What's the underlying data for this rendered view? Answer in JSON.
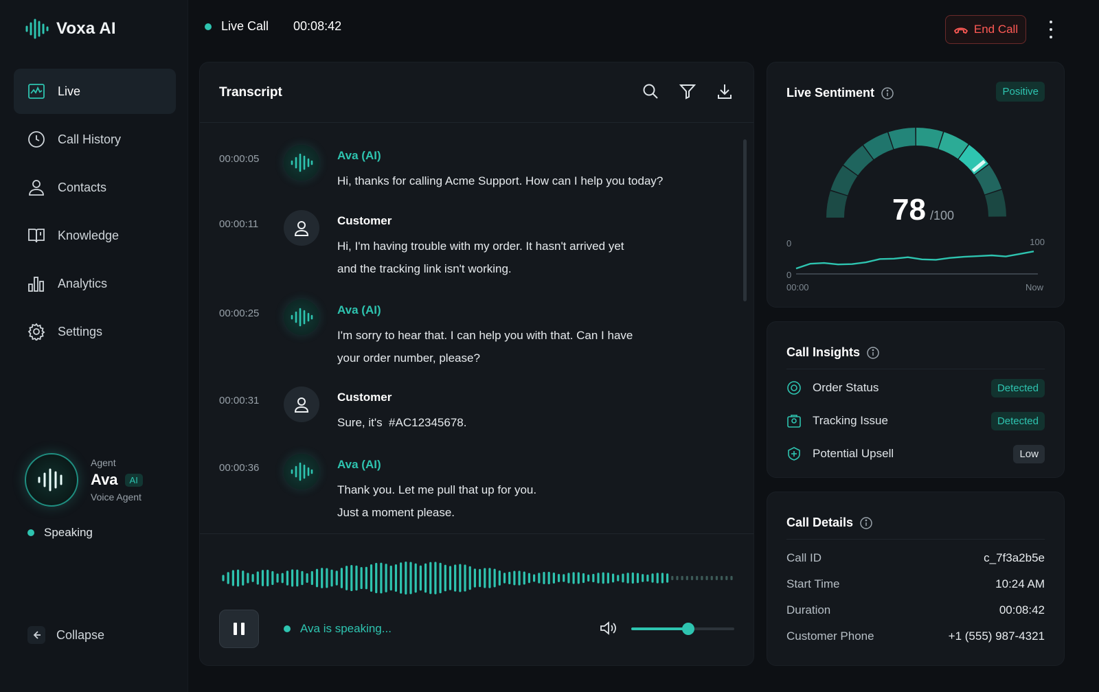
{
  "app": {
    "name": "Voxa AI"
  },
  "nav": {
    "items": [
      {
        "label": "Live",
        "icon": "live-monitor-icon",
        "active": true
      },
      {
        "label": "Call History",
        "icon": "clock-icon"
      },
      {
        "label": "Contacts",
        "icon": "user-icon"
      },
      {
        "label": "Knowledge",
        "icon": "book-icon"
      },
      {
        "label": "Analytics",
        "icon": "bar-chart-icon"
      },
      {
        "label": "Settings",
        "icon": "gear-icon"
      }
    ],
    "collapse_label": "Collapse"
  },
  "agent": {
    "role_label": "Agent",
    "name": "Ava",
    "badge": "AI",
    "subtitle": "Voice Agent",
    "status": "Speaking"
  },
  "topbar": {
    "status": "Live Call",
    "elapsed": "00:08:42",
    "end_call_label": "End Call"
  },
  "transcript": {
    "title": "Transcript",
    "messages": [
      {
        "time": "00:00:05",
        "speaker": "Ava (AI)",
        "type": "ai",
        "lines": [
          "Hi, thanks for calling Acme Support. How can I help you today?"
        ]
      },
      {
        "time": "00:00:11",
        "speaker": "Customer",
        "type": "customer",
        "lines": [
          "Hi, I'm having trouble with my order. It hasn't arrived yet",
          "and the tracking link isn't working."
        ]
      },
      {
        "time": "00:00:25",
        "speaker": "Ava (AI)",
        "type": "ai",
        "lines": [
          "I'm sorry to hear that. I can help you with that. Can I have",
          "your order number, please?"
        ]
      },
      {
        "time": "00:00:31",
        "speaker": "Customer",
        "type": "customer",
        "lines": [
          "Sure, it's  #AC12345678."
        ]
      },
      {
        "time": "00:00:36",
        "speaker": "Ava (AI)",
        "type": "ai",
        "lines": [
          "Thank you. Let me pull that up for you.",
          "Just a moment please."
        ]
      }
    ],
    "player": {
      "status_text": "Ava is speaking...",
      "volume": 0.55
    }
  },
  "sentiment": {
    "title": "Live Sentiment",
    "badge": "Positive",
    "score": 78,
    "max_label": "/100",
    "trend": {
      "y_min_label": "0",
      "y_max_label": "100",
      "x_start_label": "00:00",
      "x_end_label": "Now",
      "baseline_label": "0",
      "values": [
        15,
        28,
        30,
        26,
        27,
        32,
        41,
        42,
        46,
        40,
        39,
        44,
        47,
        49,
        51,
        48,
        55,
        62
      ]
    }
  },
  "insights": {
    "title": "Call Insights",
    "items": [
      {
        "label": "Order Status",
        "tag": "Detected",
        "tag_type": "det",
        "icon": "order-status-icon"
      },
      {
        "label": "Tracking Issue",
        "tag": "Detected",
        "tag_type": "det",
        "icon": "tracking-icon"
      },
      {
        "label": "Potential Upsell",
        "tag": "Low",
        "tag_type": "low",
        "icon": "upsell-icon"
      }
    ]
  },
  "details": {
    "title": "Call Details",
    "rows": [
      {
        "key": "Call ID",
        "value": "c_7f3a2b5e"
      },
      {
        "key": "Start Time",
        "value": "10:24 AM"
      },
      {
        "key": "Duration",
        "value": "00:08:42"
      },
      {
        "key": "Customer Phone",
        "value": "+1 (555) 987-4321"
      }
    ]
  },
  "colors": {
    "accent": "#2ec4b0",
    "danger": "#ff5a55",
    "background": "#0d1014",
    "panel": "#14181d"
  }
}
